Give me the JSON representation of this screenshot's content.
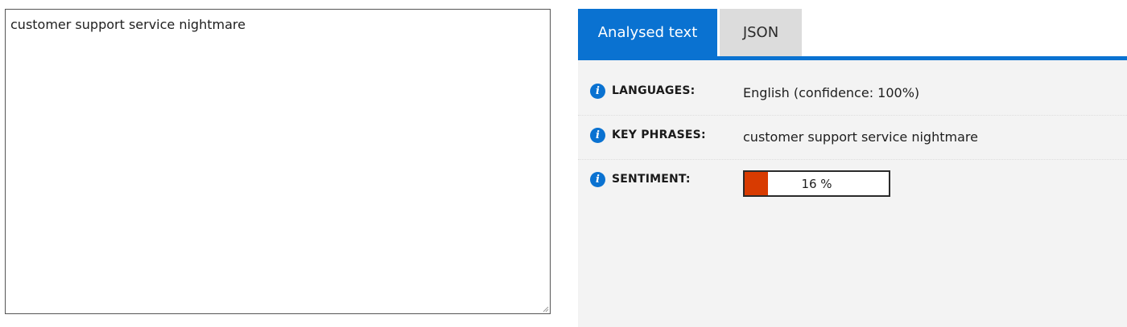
{
  "input": {
    "text": "customer support service nightmare"
  },
  "tabs": [
    {
      "label": "Analysed text",
      "active": true
    },
    {
      "label": "JSON",
      "active": false
    }
  ],
  "results": {
    "languages": {
      "label": "LANGUAGES:",
      "value": "English (confidence: 100%)",
      "icon": "info-icon"
    },
    "key_phrases": {
      "label": "KEY PHRASES:",
      "value": "customer support service nightmare",
      "icon": "info-icon"
    },
    "sentiment": {
      "label": "SENTIMENT:",
      "display": "16 %",
      "percent": 16,
      "icon": "info-icon",
      "fill_color": "#d83b01"
    }
  },
  "colors": {
    "accent": "#0a72d1",
    "panel_background": "#f3f3f3",
    "inactive_tab": "#dcdcdc"
  }
}
